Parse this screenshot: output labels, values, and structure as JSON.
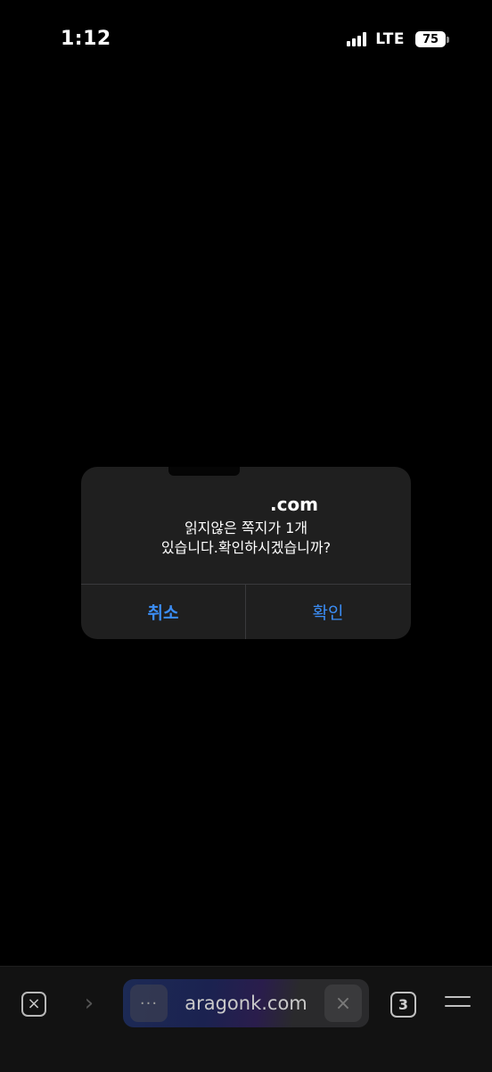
{
  "status_bar": {
    "time": "1:12",
    "network": "LTE",
    "battery": "75"
  },
  "alert": {
    "title": ".com",
    "message_line1": "읽지않은 쪽지가 1개",
    "message_line2": "있습니다.확인하시겠습니까?",
    "cancel_label": "취소",
    "confirm_label": "확인",
    "button_color": "#3b8df5"
  },
  "toolbar": {
    "close_icon": "×",
    "forward_icon": "›",
    "more_icon": "···",
    "url": "aragonk.com",
    "clear_icon": "×",
    "tab_count": "3"
  }
}
